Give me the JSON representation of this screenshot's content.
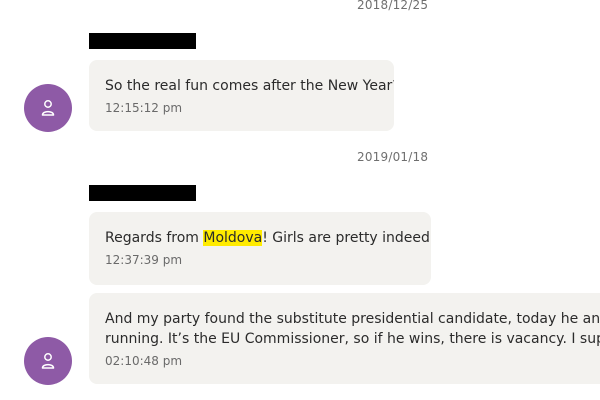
{
  "messages": [
    {
      "date": "2018/12/25",
      "text": "So the real fun comes after the New Year?",
      "time": "12:15:12 pm"
    },
    {
      "date": "2019/01/18",
      "text_before": "Regards from ",
      "text_highlight": "Moldova",
      "text_after": "! Girls are pretty indeed:)",
      "time": "12:37:39 pm"
    },
    {
      "line1": "And my party found the substitute presidential candidate, today he announced",
      "line2": "running. It’s the EU Commissioner, so if he wins, there is vacancy. I support him",
      "time": "02:10:48 pm"
    }
  ],
  "colors": {
    "avatar_bg": "#8e5aa6",
    "bubble_bg": "#f3f2ef",
    "search_highlight": "#ffeb00",
    "redaction": "#000000"
  },
  "icons": {
    "avatar": "person-icon"
  }
}
